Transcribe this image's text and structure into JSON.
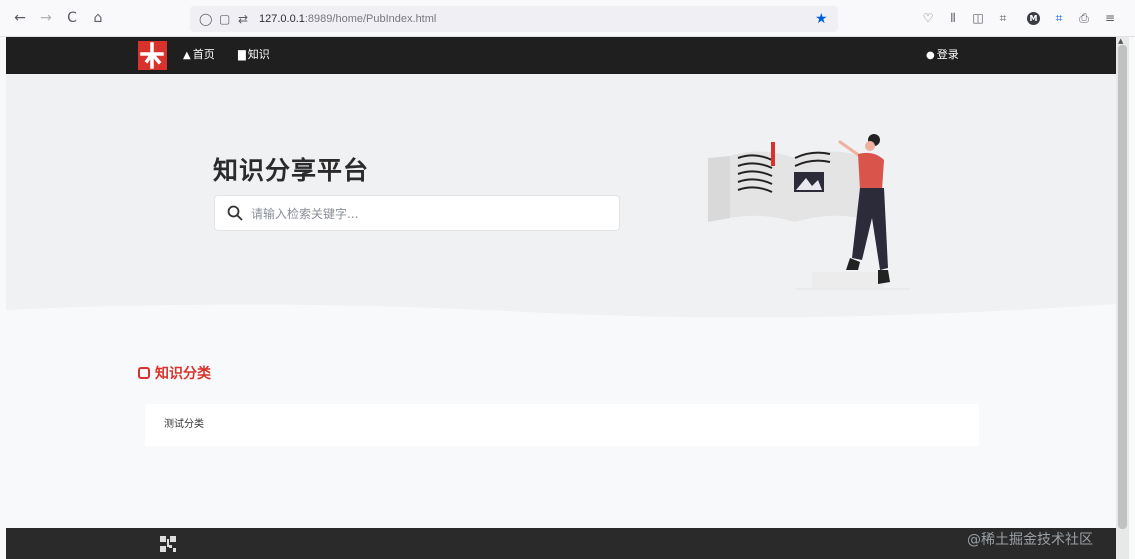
{
  "browser": {
    "back_icon": "←",
    "forward_icon": "→",
    "reload_icon": "C",
    "home_icon": "⌂",
    "url_host": "127.0.0.1",
    "url_rest": ":8989/home/PubIndex.html"
  },
  "navbar": {
    "home_label": "首页",
    "knowledge_label": "知识",
    "login_label": "登录"
  },
  "hero": {
    "title": "知识分享平台",
    "search_placeholder": "请输入检索关键字..."
  },
  "section": {
    "title": "知识分类",
    "categories": [
      "测试分类"
    ]
  },
  "watermark": "@稀土掘金技术社区",
  "colors": {
    "accent": "#d9322c",
    "navbar": "#1f1f1f",
    "hero_bg": "#f0f1f3",
    "page_bg": "#f8f9fb"
  }
}
